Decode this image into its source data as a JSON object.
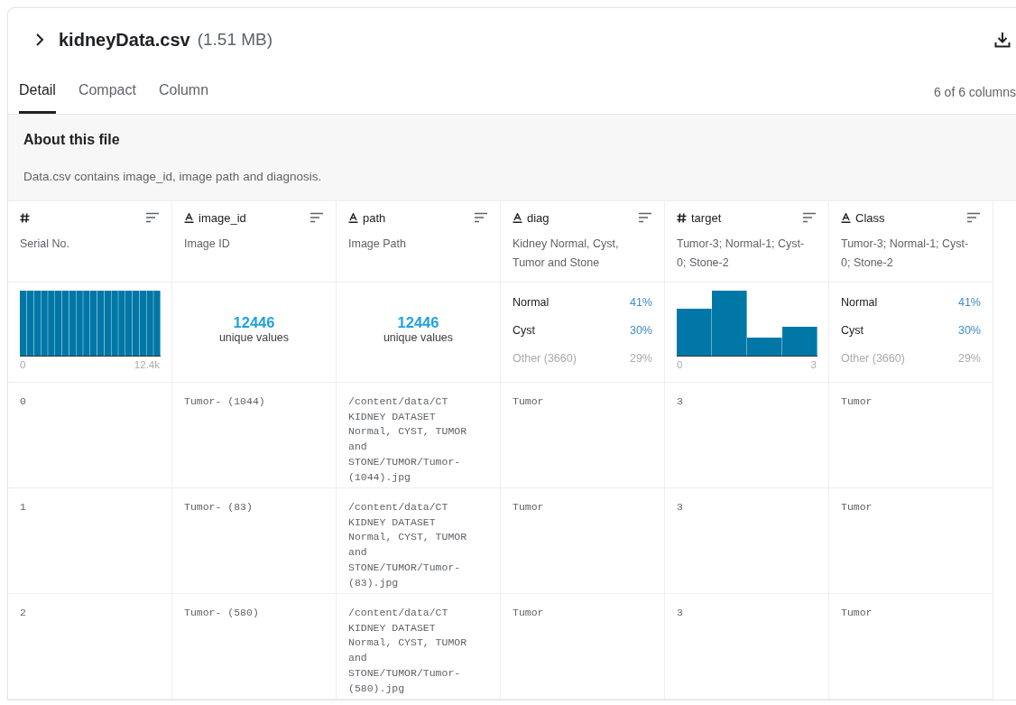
{
  "file": {
    "name": "kidneyData.csv",
    "size": "(1.51 MB)"
  },
  "tabs": [
    {
      "label": "Detail",
      "selected": true
    },
    {
      "label": "Compact",
      "selected": false
    },
    {
      "label": "Column",
      "selected": false
    }
  ],
  "column_count": "6 of 6 columns",
  "about": {
    "title": "About this file",
    "description": "Data.csv contains image_id, image path and diagnosis."
  },
  "columns": [
    {
      "kind": "number",
      "description": "Serial No.",
      "summary": {
        "kind": "uniform-histogram",
        "min": "0",
        "max": "12.4k"
      }
    },
    {
      "kind": "string",
      "name": "image_id",
      "description": "Image ID",
      "summary": {
        "kind": "unique",
        "count": "12446",
        "label": "unique values"
      }
    },
    {
      "kind": "string",
      "name": "path",
      "description": "Image Path",
      "summary": {
        "kind": "unique",
        "count": "12446",
        "label": "unique values"
      }
    },
    {
      "kind": "string",
      "name": "diag",
      "description": "Kidney Normal, Cyst, Tumor and Stone",
      "summary": {
        "kind": "categories",
        "items": [
          {
            "label": "Normal",
            "share": "41%",
            "other": false
          },
          {
            "label": "Cyst",
            "share": "30%",
            "other": false
          },
          {
            "label": "Other (3660)",
            "share": "29%",
            "other": true
          }
        ]
      }
    },
    {
      "kind": "number",
      "name": "target",
      "description": "Tumor-3; Normal-1; Cyst-0; Stone-2",
      "summary": {
        "kind": "histogram",
        "min": "0",
        "max": "3"
      }
    },
    {
      "kind": "string",
      "name": "Class",
      "description": "Tumor-3; Normal-1; Cyst-0; Stone-2",
      "summary": {
        "kind": "categories",
        "items": [
          {
            "label": "Normal",
            "share": "41%",
            "other": false
          },
          {
            "label": "Cyst",
            "share": "30%",
            "other": false
          },
          {
            "label": "Other (3660)",
            "share": "29%",
            "other": true
          }
        ]
      }
    }
  ],
  "rows": [
    [
      "0",
      "Tumor- (1044)",
      "/content/data/CT KIDNEY DATASET Normal, CYST, TUMOR and STONE/TUMOR/Tumor- (1044).jpg",
      "Tumor",
      "3",
      "Tumor"
    ],
    [
      "1",
      "Tumor- (83)",
      "/content/data/CT KIDNEY DATASET Normal, CYST, TUMOR and STONE/TUMOR/Tumor- (83).jpg",
      "Tumor",
      "3",
      "Tumor"
    ],
    [
      "2",
      "Tumor- (580)",
      "/content/data/CT KIDNEY DATASET Normal, CYST, TUMOR and STONE/TUMOR/Tumor- (580).jpg",
      "Tumor",
      "3",
      "Tumor"
    ]
  ]
}
